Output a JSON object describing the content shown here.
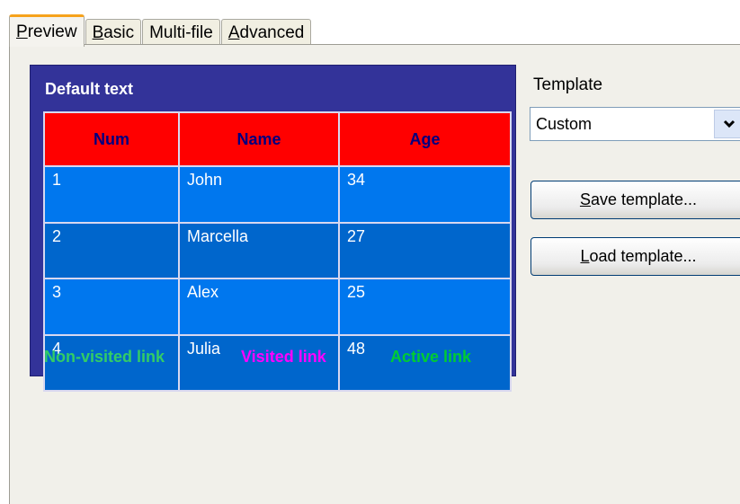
{
  "tabs": [
    {
      "pre": "",
      "key": "P",
      "post": "review",
      "active": true
    },
    {
      "pre": "",
      "key": "B",
      "post": "asic",
      "active": false
    },
    {
      "pre": "Multi-file",
      "key": "",
      "post": "",
      "active": false
    },
    {
      "pre": "",
      "key": "A",
      "post": "dvanced",
      "active": false
    }
  ],
  "preview": {
    "default_text": "Default text",
    "headers": [
      "Num",
      "Name",
      "Age"
    ],
    "rows": [
      [
        "1",
        "John",
        "34"
      ],
      [
        "2",
        "Marcella",
        "27"
      ],
      [
        "3",
        "Alex",
        "25"
      ],
      [
        "4",
        "Julia",
        "48"
      ]
    ],
    "links": {
      "non_visited": "Non-visited link",
      "visited": "Visited link",
      "active": "Active link"
    }
  },
  "colors": {
    "preview_background": "#333399",
    "header_background": "#ff0000",
    "header_text": "#000080",
    "row_odd": "#0077ee",
    "row_even": "#0066cc",
    "non_visited_link": "#33cc66",
    "visited_link": "#ff00ff",
    "active_link": "#00cc33"
  },
  "template": {
    "label": "Template",
    "selected": "Custom",
    "dropdown_icon": "chevron-down-icon"
  },
  "buttons": {
    "save": {
      "key": "S",
      "rest": "ave template..."
    },
    "load": {
      "key": "L",
      "rest": "oad template..."
    }
  }
}
